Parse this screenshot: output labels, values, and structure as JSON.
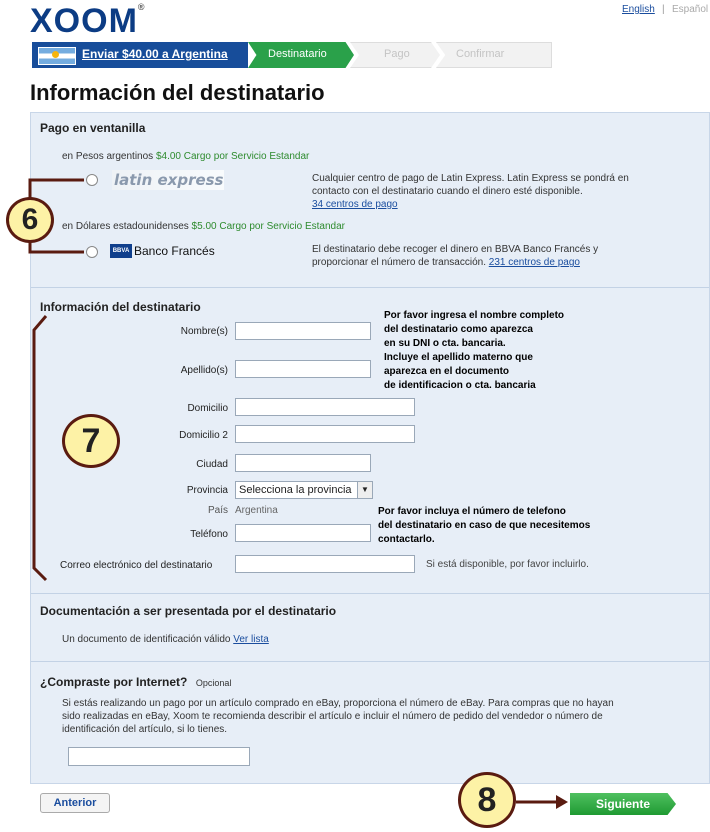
{
  "header": {
    "logo": "XOOM",
    "lang_english": "English",
    "lang_sep": "|",
    "lang_spanish": "Español"
  },
  "progress": {
    "step1": "Enviar $40.00 a Argentina",
    "step2": "Destinatario",
    "step3": "Pago",
    "step4": "Confirmar"
  },
  "page_title": "Información del destinatario",
  "pickup": {
    "title": "Pago en ventanilla",
    "option1_prefix": "en Pesos argentinos",
    "option1_fee": "$4.00 Cargo por Servicio Estandar",
    "option1_logo": "latin express",
    "option1_desc": "Cualquier centro de pago de Latin Express. Latin Express se pondrá en contacto con el destinatario cuando el dinero esté disponible.",
    "option1_link": "34 centros de pago",
    "option2_prefix": "en Dólares estadounidenses",
    "option2_fee": "$5.00 Cargo por Servicio Estandar",
    "option2_logo_badge": "BBVA",
    "option2_logo": "Banco Francés",
    "option2_desc": "El destinatario debe recoger el dinero en BBVA Banco Francés y proporcionar el número de transacción.",
    "option2_link": "231 centros de pago"
  },
  "recipient": {
    "title": "Información del destinatario",
    "nombre_label": "Nombre(s)",
    "apellido_label": "Apellido(s)",
    "domicilio_label": "Domicilio",
    "domicilio2_label": "Domicilio 2",
    "ciudad_label": "Ciudad",
    "provincia_label": "Provincia",
    "provincia_value": "Selecciona la provincia",
    "pais_label": "País",
    "pais_value": "Argentina",
    "telefono_label": "Teléfono",
    "email_label": "Correo electrónico del destinatario",
    "email_hint": "Si está disponible, por favor incluirlo.",
    "note_name": [
      "Por favor ingresa el nombre completo",
      "del destinatario como aparezca",
      "en su DNI o cta. bancaria.",
      "Incluye el apellido materno que",
      "aparezca en el documento",
      "de identificacion o cta. bancaria"
    ],
    "note_phone": [
      "Por favor incluya el número de telefono",
      "del destinatario en caso de que necesitemos",
      "contactarlo."
    ]
  },
  "docs": {
    "title": "Documentación a ser presentada por el destinatario",
    "text": "Un documento de identificación válido",
    "link": "Ver lista"
  },
  "internet": {
    "title": "¿Compraste por Internet?",
    "optional": "Opcional",
    "text": "Si estás realizando un pago por un artículo comprado en eBay, proporciona el número de eBay. Para compras que no hayan sido realizadas en eBay, Xoom te recomienda describir el artículo e incluir el número de pedido del vendedor o número de identificación del artículo, si lo tienes."
  },
  "buttons": {
    "back": "Anterior",
    "next": "Siguiente"
  },
  "callouts": {
    "c6": "6",
    "c7": "7",
    "c8": "8"
  },
  "colors": {
    "brand_blue": "#174d9a",
    "step_green": "#2aa14a",
    "callout_fill": "#fdf2a6",
    "callout_border": "#5a1b10",
    "panel_bg": "#e7eef7"
  }
}
